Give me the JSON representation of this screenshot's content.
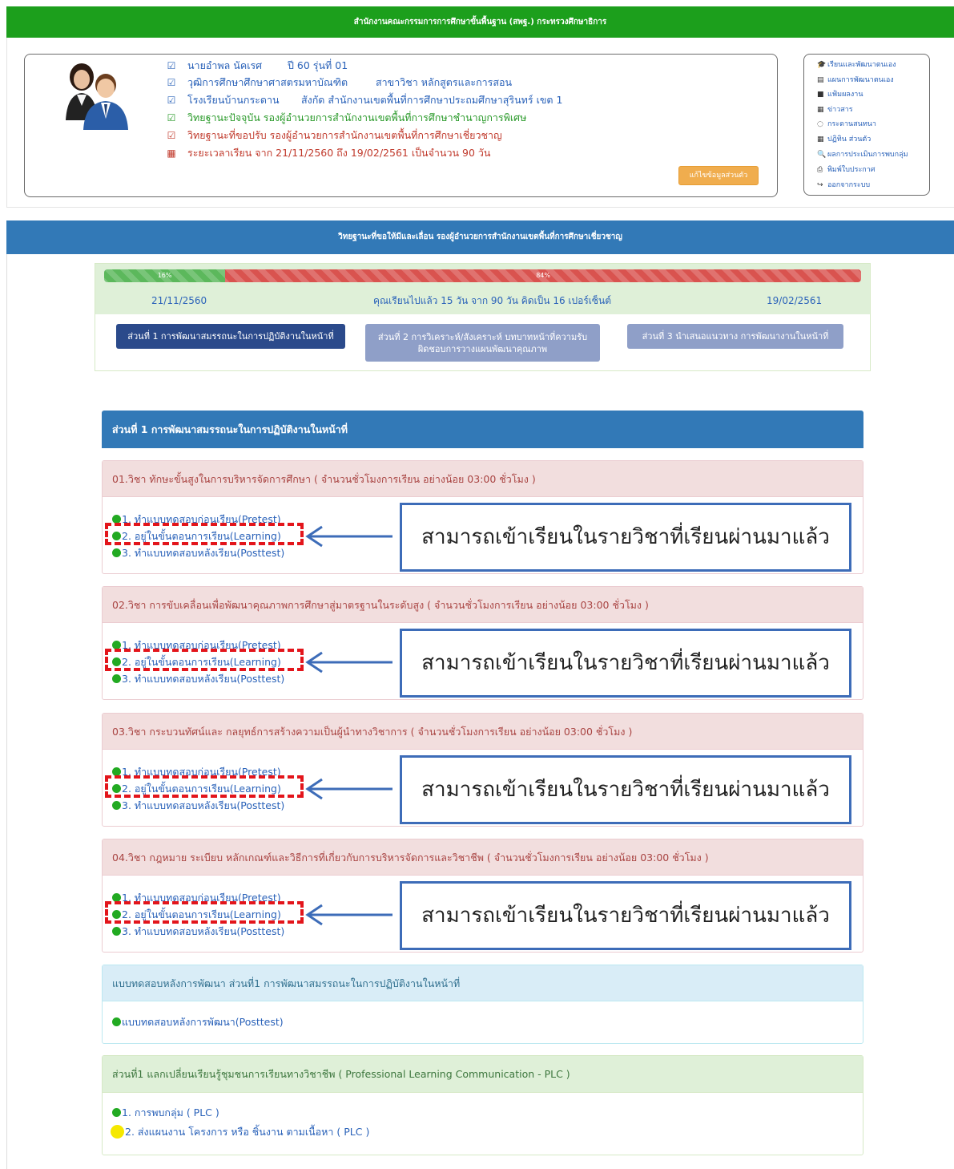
{
  "header": {
    "title": "สำนักงานคณะกรรมการการศึกษาขั้นพื้นฐาน (สพฐ.) กระทรวงศึกษาธิการ"
  },
  "profile": {
    "name": "นายอำพล นัคเรศ",
    "batch": "ปี 60 รุ่นที่ 01",
    "degree": "วุฒิการศึกษาศึกษาศาสตรมหาบัณฑิต",
    "major": "สาขาวิชา หลักสูตรและการสอน",
    "school": "โรงเรียนบ้านกระดาน",
    "affiliation": "สังกัด สำนักงานเขตพื้นที่การศึกษาประถมศึกษาสุรินทร์ เขต 1",
    "current_rank": "วิทยฐานะปัจจุบัน รองผู้อำนวยการสำนักงานเขตพื้นที่การศึกษาชำนาญการพิเศษ",
    "target_rank": "วิทยฐานะที่ขอปรับ รองผู้อำนวยการสำนักงานเขตพื้นที่การศึกษาเชี่ยวชาญ",
    "period": "ระยะเวลาเรียน จาก 21/11/2560 ถึง 19/02/2561   เป็นจำนวน 90 วัน",
    "edit_button": "แก้ไขข้อมูลส่วนตัว"
  },
  "menu": {
    "items": [
      {
        "icon": "graduation-cap-icon",
        "glyph": "🎓",
        "label": "เรียนและพัฒนาตนเอง"
      },
      {
        "icon": "calendar-icon",
        "glyph": "▤",
        "label": "แผนการพัฒนาตนเอง"
      },
      {
        "icon": "folder-icon",
        "glyph": "■",
        "label": "แฟ้มผลงาน"
      },
      {
        "icon": "newspaper-icon",
        "glyph": "▦",
        "label": "ข่าวสาร"
      },
      {
        "icon": "comments-icon",
        "glyph": "◌",
        "label": "กระดานสนทนา"
      },
      {
        "icon": "calendar-days-icon",
        "glyph": "▦",
        "label": "ปฏิทิน ส่วนตัว"
      },
      {
        "icon": "search-icon",
        "glyph": "🔍",
        "label": "ผลการประเมินการพบกลุ่ม"
      },
      {
        "icon": "print-icon",
        "glyph": "⎙",
        "label": "พิมพ์ใบประกาศ"
      },
      {
        "icon": "sign-out-icon",
        "glyph": "↪",
        "label": "ออกจากระบบ"
      }
    ]
  },
  "section": {
    "title": "วิทยฐานะที่ขอให้มีและเลื่อน รองผู้อำนวยการสำนักงานเขตพื้นที่การศึกษาเชี่ยวชาญ"
  },
  "progress": {
    "done_percent": 16,
    "done_label": "16%",
    "remaining_label": "84%",
    "start_date": "21/11/2560",
    "end_date": "19/02/2561",
    "summary": "คุณเรียนไปแล้ว 15 วัน จาก 90 วัน คิดเป็น 16 เปอร์เซ็นต์",
    "parts": [
      "ส่วนที่ 1 การพัฒนาสมรรถนะในการปฏิบัติงานในหน้าที่",
      "ส่วนที่ 2 การวิเคราะห์/สังเคราะห์ บทบาทหน้าที่ความรับผิดชอบการวางแผนพัฒนาคุณภาพ",
      "ส่วนที่ 3 นำเสนอแนวทาง การพัฒนางานในหน้าที่"
    ]
  },
  "part1": {
    "title": "ส่วนที่ 1 การพัฒนาสมรรถนะในการปฏิบัติงานในหน้าที่",
    "courses": [
      {
        "title": "01.วิชา ทักษะขั้นสูงในการบริหารจัดการศึกษา ( จำนวนชั่วโมงการเรียน อย่างน้อย 03:00 ชั่วโมง )",
        "steps": [
          "1. ทำแบบทดสอบก่อนเรียน(Pretest)",
          "2. อยู่ในขั้นตอนการเรียน(Learning)",
          "3. ทำแบบทดสอบหลังเรียน(Posttest)"
        ]
      },
      {
        "title": "02.วิชา การขับเคลื่อนเพื่อพัฒนาคุณภาพการศึกษาสู่มาตรฐานในระดับสูง ( จำนวนชั่วโมงการเรียน อย่างน้อย 03:00 ชั่วโมง )",
        "steps": [
          "1. ทำแบบทดสอบก่อนเรียน(Pretest)",
          "2. อยู่ในขั้นตอนการเรียน(Learning)",
          "3. ทำแบบทดสอบหลังเรียน(Posttest)"
        ]
      },
      {
        "title": "03.วิชา กระบวนทัศน์และ กลยุทธ์การสร้างความเป็นผู้นำทางวิชาการ ( จำนวนชั่วโมงการเรียน อย่างน้อย 03:00 ชั่วโมง )",
        "steps": [
          "1. ทำแบบทดสอบก่อนเรียน(Pretest)",
          "2. อยู่ในขั้นตอนการเรียน(Learning)",
          "3. ทำแบบทดสอบหลังเรียน(Posttest)"
        ]
      },
      {
        "title": "04.วิชา กฎหมาย ระเบียบ หลักเกณฑ์และวิธีการที่เกี่ยวกับการบริหารจัดการและวิชาชีพ ( จำนวนชั่วโมงการเรียน อย่างน้อย 03:00 ชั่วโมง )",
        "steps": [
          "1. ทำแบบทดสอบก่อนเรียน(Pretest)",
          "2. อยู่ในขั้นตอนการเรียน(Learning)",
          "3. ทำแบบทดสอบหลังเรียน(Posttest)"
        ]
      }
    ],
    "annotation": "สามารถเข้าเรียนในรายวิชาที่เรียนผ่านมาแล้ว"
  },
  "posttest_panel": {
    "title": "แบบทดสอบหลังการพัฒนา ส่วนที่1 การพัฒนาสมรรถนะในการปฏิบัติงานในหน้าที่",
    "item": "แบบทดสอบหลังการพัฒนา(Posttest)"
  },
  "plc_panel": {
    "title": "ส่วนที่1 แลกเปลี่ยนเรียนรู้ชุมชนการเรียนทางวิชาชีพ ( Professional Learning Communication - PLC )",
    "items": [
      "1. การพบกลุ่ม ( PLC )",
      "2. ส่งแผนงาน โครงการ หรือ ชิ้นงาน ตามเนื้อหา ( PLC )"
    ]
  },
  "colors": {
    "header_green": "#1c9f1c",
    "section_blue": "#3279b7",
    "annotation_red": "#e3151b",
    "annotation_blue": "#3d6cb8",
    "step_done": "#22aa22",
    "step_pending": "#f5e800"
  }
}
